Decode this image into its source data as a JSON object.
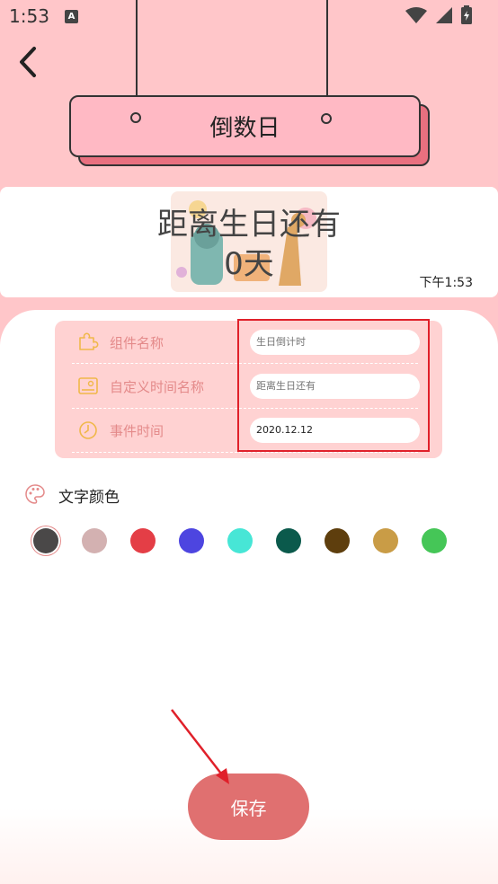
{
  "status_bar": {
    "time": "1:53",
    "notification_badge": "A",
    "icons": [
      "wifi-icon",
      "signal-icon",
      "battery-icon"
    ]
  },
  "header": {
    "title": "倒数日",
    "back_icon": "chevron-left-icon"
  },
  "preview": {
    "title": "距离生日还有",
    "days": "0天",
    "clock": "下午1:53"
  },
  "form": {
    "rows": [
      {
        "label": "组件名称",
        "icon": "puzzle-icon",
        "value": "",
        "placeholder": "生日倒计时"
      },
      {
        "label": "自定义时间名称",
        "icon": "id-card-icon",
        "value": "",
        "placeholder": "距离生日还有"
      },
      {
        "label": "事件时间",
        "icon": "clock-icon",
        "value": "2020.12.12",
        "placeholder": ""
      }
    ]
  },
  "text_color": {
    "label": "文字颜色",
    "icon": "palette-icon",
    "swatches": [
      "#4a4848",
      "#d3b1b1",
      "#e43e46",
      "#4d45e0",
      "#47e6d6",
      "#0b5a4c",
      "#5e3e0d",
      "#c99c46",
      "#45c657"
    ],
    "selected_index": 0
  },
  "save_label": "保存",
  "colors": {
    "background": "#ffc6c9",
    "accent": "#e07070",
    "highlight": "#e0202a",
    "board": "#ffb9c4"
  }
}
